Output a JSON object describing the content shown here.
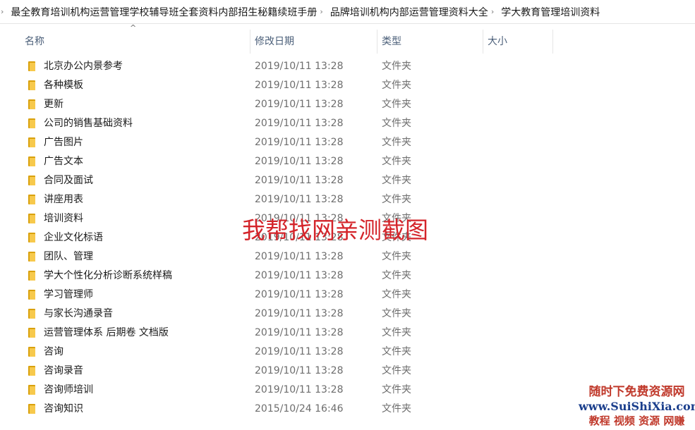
{
  "breadcrumb": {
    "items": [
      "最全教育培训机构运营管理学校辅导班全套资料内部招生秘籍续班手册",
      "品牌培训机构内部运营管理资料大全",
      "学大教育管理培训资料"
    ]
  },
  "columns": {
    "name": "名称",
    "date": "修改日期",
    "type": "类型",
    "size": "大小",
    "sort_indicator": "^"
  },
  "files": [
    {
      "name": "北京办公内景参考",
      "date": "2019/10/11 13:28",
      "type": "文件夹"
    },
    {
      "name": "各种模板",
      "date": "2019/10/11 13:28",
      "type": "文件夹"
    },
    {
      "name": "更新",
      "date": "2019/10/11 13:28",
      "type": "文件夹"
    },
    {
      "name": "公司的销售基础资料",
      "date": "2019/10/11 13:28",
      "type": "文件夹"
    },
    {
      "name": "广告图片",
      "date": "2019/10/11 13:28",
      "type": "文件夹"
    },
    {
      "name": "广告文本",
      "date": "2019/10/11 13:28",
      "type": "文件夹"
    },
    {
      "name": "合同及面试",
      "date": "2019/10/11 13:28",
      "type": "文件夹"
    },
    {
      "name": "讲座用表",
      "date": "2019/10/11 13:28",
      "type": "文件夹"
    },
    {
      "name": "培训资料",
      "date": "2019/10/11 13:28",
      "type": "文件夹"
    },
    {
      "name": "企业文化标语",
      "date": "2019/10/11 13:28",
      "type": "文件夹"
    },
    {
      "name": "团队、管理",
      "date": "2019/10/11 13:28",
      "type": "文件夹"
    },
    {
      "name": "学大个性化分析诊断系统样稿",
      "date": "2019/10/11 13:28",
      "type": "文件夹"
    },
    {
      "name": "学习管理师",
      "date": "2019/10/11 13:28",
      "type": "文件夹"
    },
    {
      "name": "与家长沟通录音",
      "date": "2019/10/11 13:28",
      "type": "文件夹"
    },
    {
      "name": "运营管理体系  后期卷  文档版",
      "date": "2019/10/11 13:28",
      "type": "文件夹"
    },
    {
      "name": "咨询",
      "date": "2019/10/11 13:28",
      "type": "文件夹"
    },
    {
      "name": "咨询录音",
      "date": "2019/10/11 13:28",
      "type": "文件夹"
    },
    {
      "name": "咨询师培训",
      "date": "2019/10/11 13:28",
      "type": "文件夹"
    },
    {
      "name": "咨询知识",
      "date": "2015/10/24 16:46",
      "type": "文件夹"
    }
  ],
  "overlays": {
    "watermark": "我帮找网亲测截图",
    "brand_line1": "随时下免费资源网",
    "brand_line2": "www.SuiShiXia.com",
    "brand_line3": "教程 视频 资源 网赚"
  },
  "colors": {
    "folder_icon": "#f7c94c",
    "watermark": "#d4242a",
    "header_text": "#4c607a"
  }
}
